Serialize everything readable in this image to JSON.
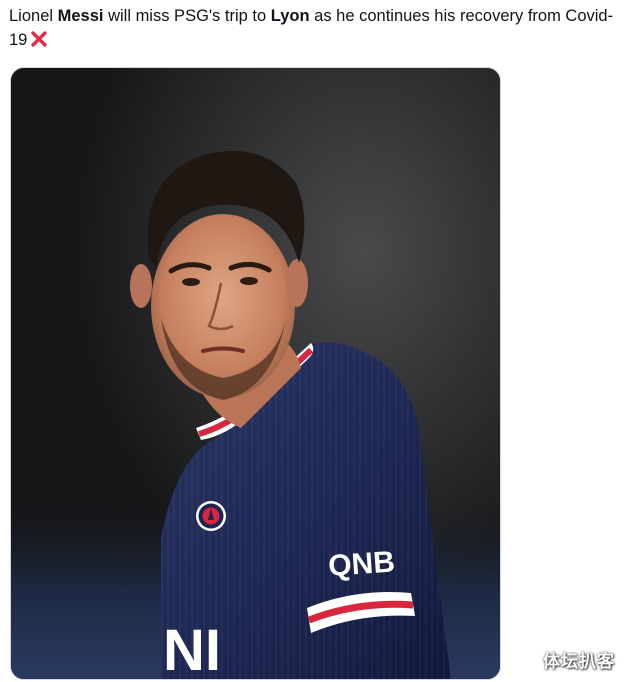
{
  "tweet": {
    "text_part1": "Lionel ",
    "bold1": "Messi",
    "text_part2": " will miss PSG's trip to ",
    "bold2": "Lyon",
    "text_part3": " as he continues his recovery from Covid-19",
    "emoji_icon": "cross-mark-icon",
    "emoji_color": "#dd2e44"
  },
  "media": {
    "sponsor_text": "QNB",
    "sleeve_letters": "NI",
    "kit_color": "#1b2550",
    "trim_color": "#d7263d",
    "badge_icon": "psg-crest-icon"
  },
  "watermark": {
    "text": "体坛扒客"
  }
}
